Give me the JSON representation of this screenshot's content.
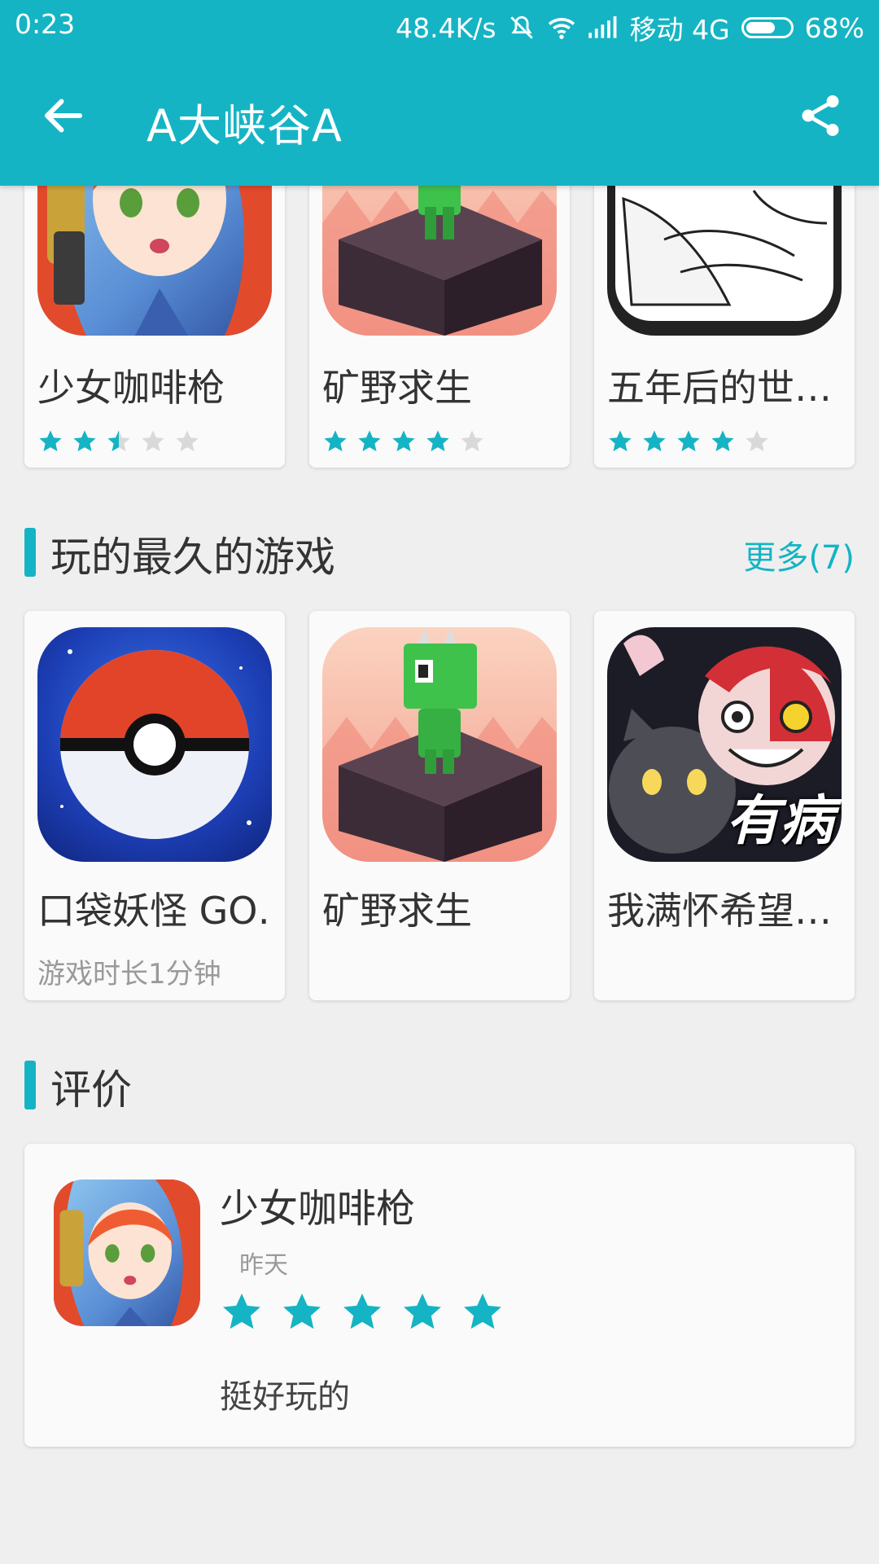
{
  "status_bar": {
    "time": "0:23",
    "speed": "48.4K/s",
    "carrier": "移动 4G",
    "battery": "68%",
    "battery_level": 0.68
  },
  "app_bar": {
    "title": "A大峡谷A",
    "back_icon": "arrow-left-icon",
    "share_icon": "share-icon"
  },
  "top_games": [
    {
      "name": "少女咖啡枪",
      "rating": 2.5
    },
    {
      "name": "矿野求生",
      "rating": 4
    },
    {
      "name": "五年后的世…",
      "rating": 4
    }
  ],
  "longest_played": {
    "title": "玩的最久的游戏",
    "more": "更多(7)",
    "items": [
      {
        "name": "口袋妖怪 GO…",
        "playtime": "游戏时长1分钟"
      },
      {
        "name": "矿野求生",
        "playtime": ""
      },
      {
        "name": "我满怀希望…",
        "playtime": "",
        "icon_text": "有病"
      }
    ]
  },
  "reviews": {
    "title": "评价",
    "items": [
      {
        "game": "少女咖啡枪",
        "date": "昨天",
        "rating": 5,
        "text": "挺好玩的"
      }
    ]
  },
  "colors": {
    "accent": "#15b4c4",
    "star_empty": "#d9d9d9"
  }
}
